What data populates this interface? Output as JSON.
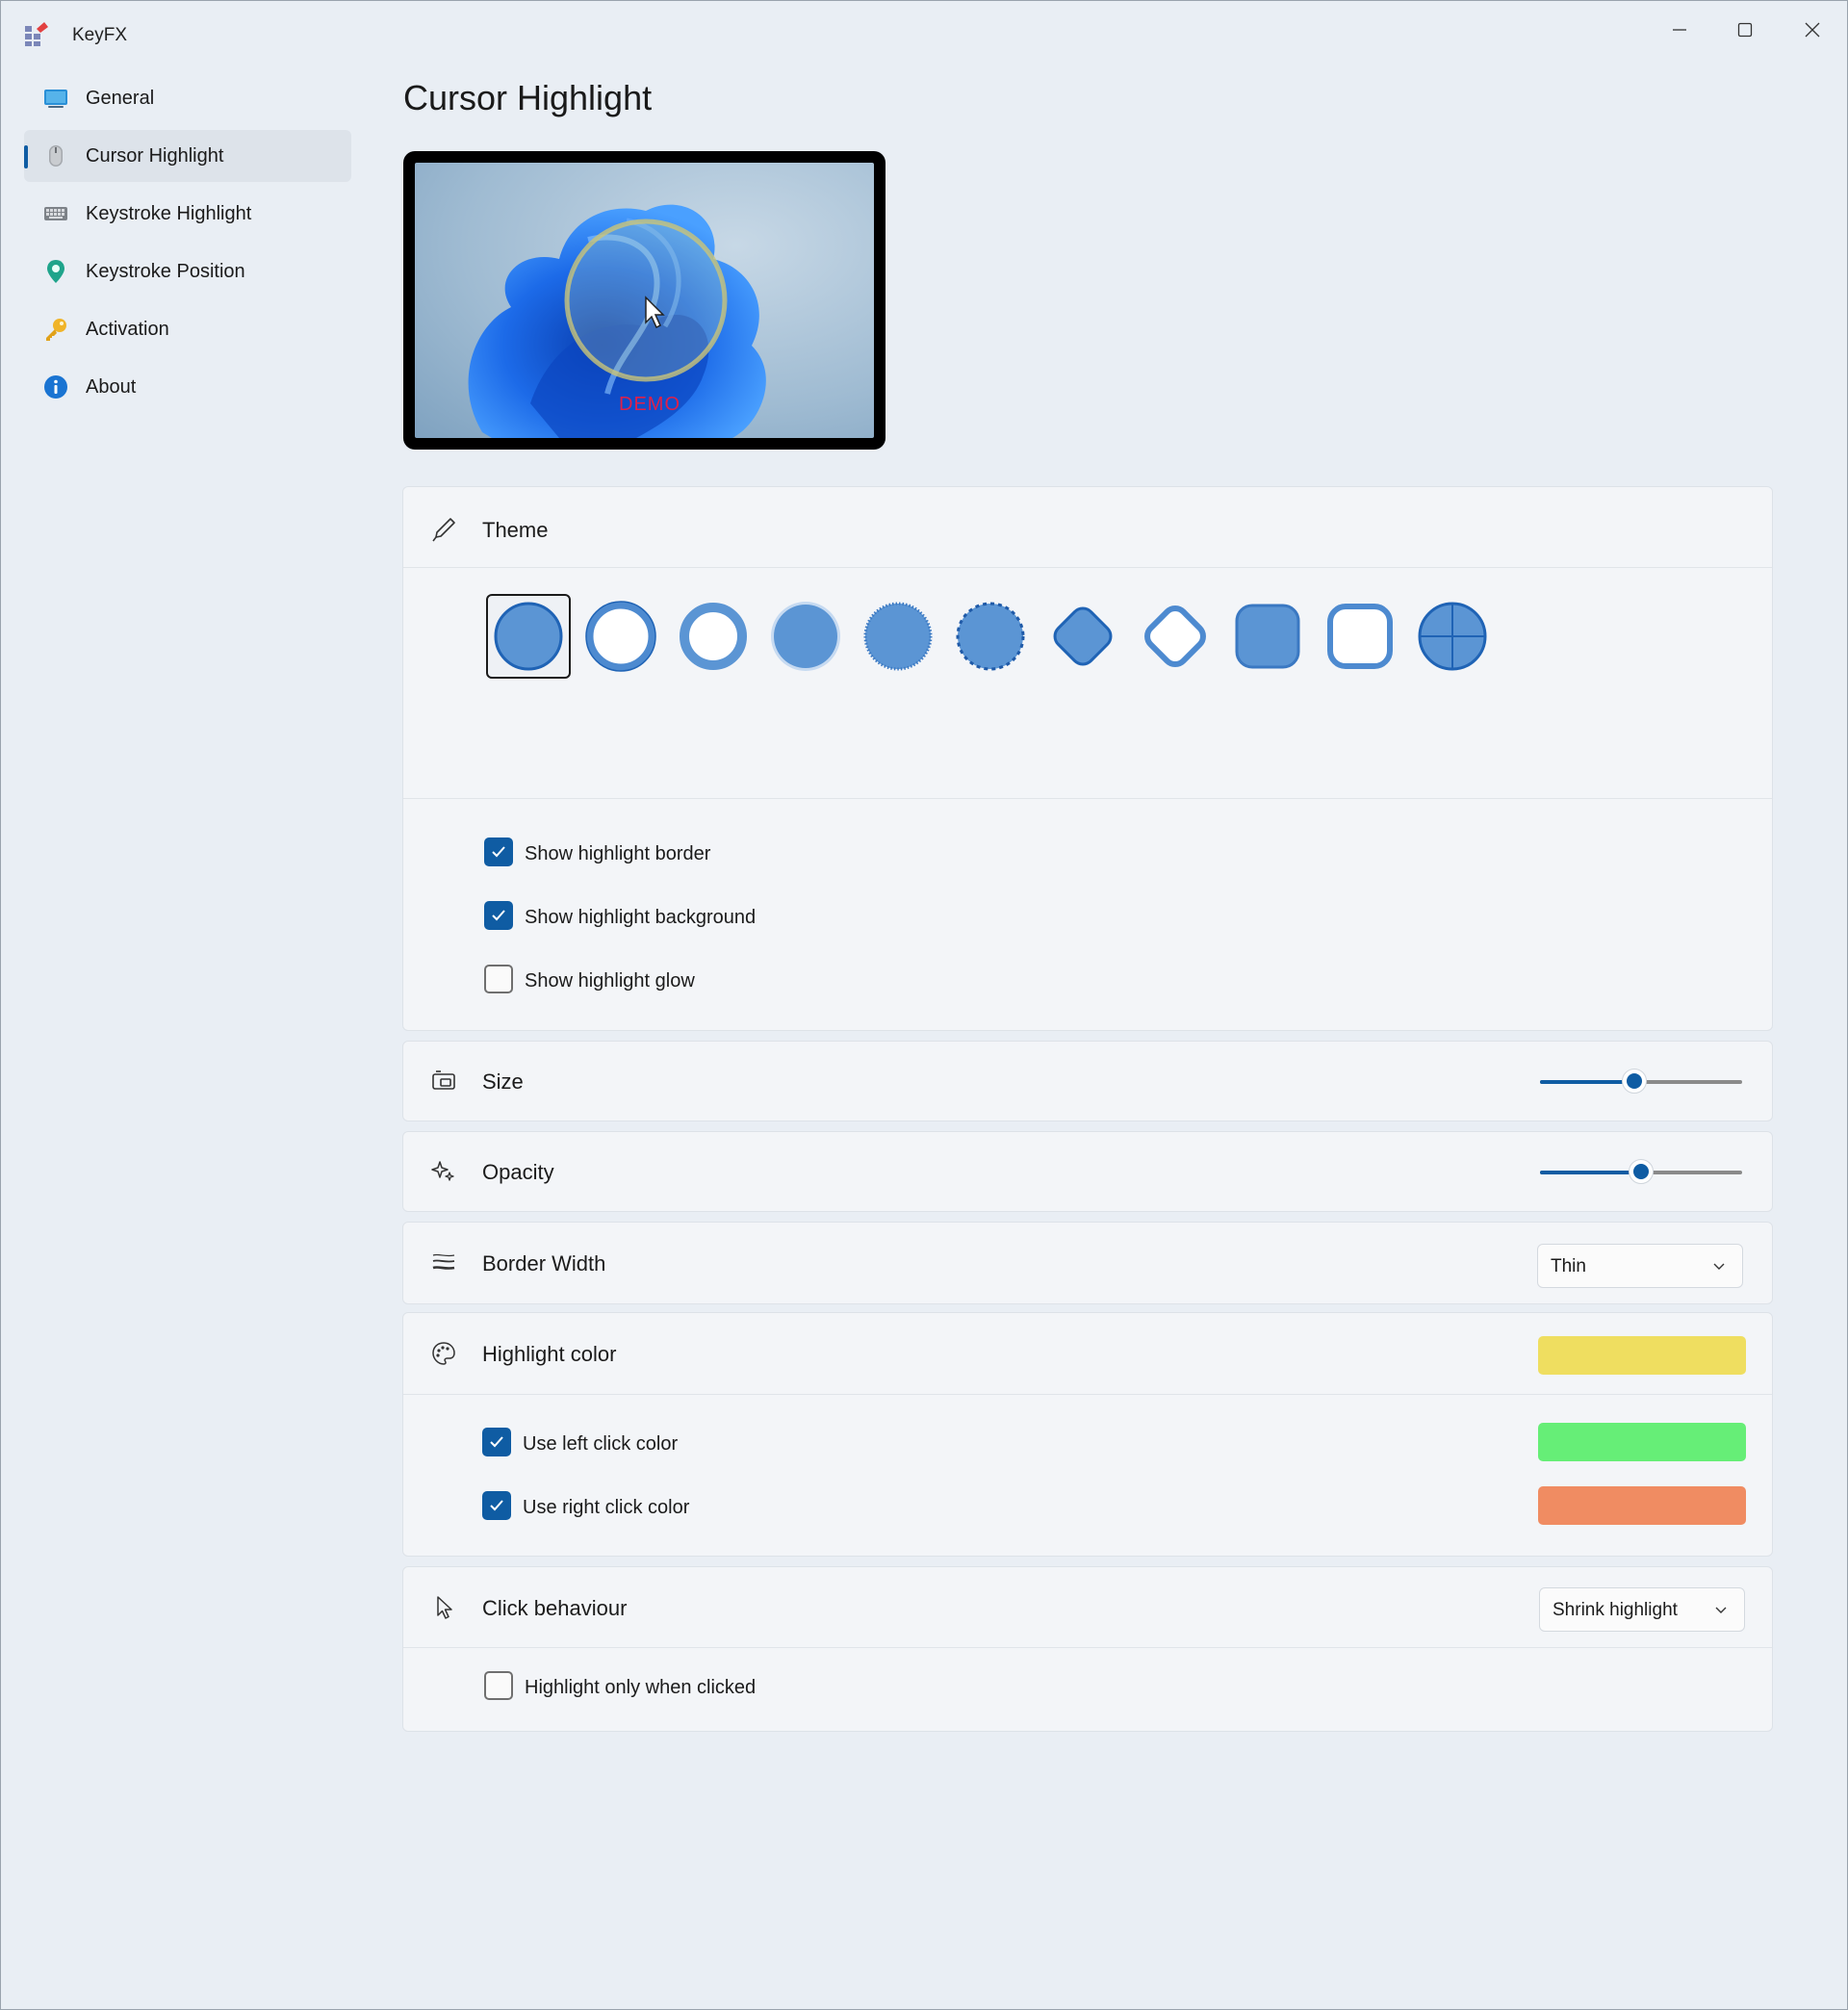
{
  "app": {
    "title": "KeyFX"
  },
  "nav": {
    "items": [
      {
        "label": "General",
        "icon": "monitor-icon",
        "selected": false
      },
      {
        "label": "Cursor Highlight",
        "icon": "mouse-icon",
        "selected": true
      },
      {
        "label": "Keystroke Highlight",
        "icon": "keyboard-icon",
        "selected": false
      },
      {
        "label": "Keystroke Position",
        "icon": "location-pin-icon",
        "selected": false
      },
      {
        "label": "Activation",
        "icon": "key-icon",
        "selected": false
      },
      {
        "label": "About",
        "icon": "info-icon",
        "selected": false
      }
    ]
  },
  "page": {
    "title": "Cursor Highlight",
    "preview_watermark": "DEMO"
  },
  "theme": {
    "title": "Theme",
    "styles": [
      "filled-circle",
      "ring-thick",
      "ring-thin",
      "filled-circle-soft",
      "filled-circle-dotted-edge",
      "dashed-circle",
      "filled-diamond",
      "ring-diamond",
      "filled-rounded-square",
      "ring-rounded-square",
      "crosshair-circle"
    ],
    "selected_index": 0,
    "options": [
      {
        "label": "Show highlight border",
        "checked": true
      },
      {
        "label": "Show highlight background",
        "checked": true
      },
      {
        "label": "Show highlight glow",
        "checked": false
      }
    ]
  },
  "size": {
    "title": "Size",
    "value": 0.46
  },
  "opacity": {
    "title": "Opacity",
    "value": 0.5
  },
  "border_width": {
    "title": "Border Width",
    "value": "Thin"
  },
  "highlight_color": {
    "title": "Highlight color",
    "color": "#efde60",
    "options": [
      {
        "label": "Use left click color",
        "checked": true,
        "color": "#66ee77"
      },
      {
        "label": "Use right click color",
        "checked": true,
        "color": "#f08c62"
      }
    ]
  },
  "click_behaviour": {
    "title": "Click behaviour",
    "value": "Shrink highlight",
    "option": {
      "label": "Highlight only when clicked",
      "checked": false
    }
  },
  "colors": {
    "accent": "#0f5ca3",
    "shape_fill": "#5b95d4",
    "shape_stroke": "#1f63b5"
  }
}
